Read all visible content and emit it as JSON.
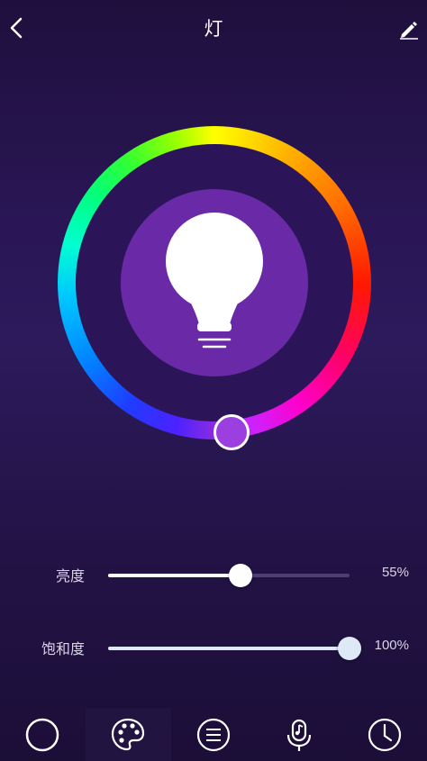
{
  "header": {
    "title": "灯",
    "back_icon": "chevron-left-icon",
    "edit_icon": "pencil-icon"
  },
  "color_wheel": {
    "selected_color": "#9b3fe0",
    "bulb_disc_color": "#6a2aa8",
    "bulb_icon": "lightbulb-icon"
  },
  "sliders": [
    {
      "label": "亮度",
      "value": 55,
      "value_text": "55%"
    },
    {
      "label": "饱和度",
      "value": 100,
      "value_text": "100%"
    }
  ],
  "bottom_nav": {
    "items": [
      {
        "icon": "circle-icon",
        "active": false
      },
      {
        "icon": "palette-icon",
        "active": true
      },
      {
        "icon": "list-icon",
        "active": false
      },
      {
        "icon": "microphone-music-icon",
        "active": false
      },
      {
        "icon": "clock-icon",
        "active": false
      }
    ]
  },
  "colors": {
    "accent": "#9b3fe0",
    "background": "#2a1656"
  }
}
